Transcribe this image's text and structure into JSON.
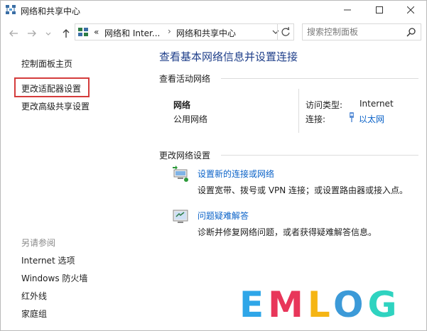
{
  "window": {
    "title": "网络和共享中心",
    "controls": [
      "minimize-icon",
      "maximize-icon",
      "close-icon"
    ]
  },
  "navigation": {
    "breadcrumb_prefix": "«",
    "breadcrumb": [
      "网络和 Inter...",
      "网络和共享中心"
    ],
    "separator": "›",
    "search_placeholder": "搜索控制面板"
  },
  "left_pane": {
    "links": [
      "控制面板主页",
      "更改适配器设置",
      "更改高级共享设置"
    ],
    "highlighted_link": "更改适配器设置",
    "see_also_header": "另请参阅",
    "see_also": [
      "Internet 选项",
      "Windows 防火墙",
      "红外线",
      "家庭组"
    ]
  },
  "main": {
    "heading": "查看基本网络信息并设置连接",
    "active_networks_header": "查看活动网络",
    "network_name": "网络",
    "network_type": "公用网络",
    "access_type_label": "访问类型:",
    "access_type_value": "Internet",
    "connections_label": "连接:",
    "connection_link": "以太网",
    "change_settings_header": "更改网络设置",
    "tasks": [
      {
        "title": "设置新的连接或网络",
        "desc": "设置宽带、拨号或 VPN 连接；或设置路由器或接入点。",
        "icon": "new-connection-icon"
      },
      {
        "title": "问题疑难解答",
        "desc": "诊断并修复网络问题，或者获得疑难解答信息。",
        "icon": "troubleshoot-icon"
      }
    ]
  },
  "watermark": {
    "text": "EMLOG",
    "colors": [
      "#2fa6e8",
      "#e8365a",
      "#f5b514",
      "#3c9ad8",
      "#2fd3c0"
    ]
  },
  "colors": {
    "link": "#0a62c8",
    "heading": "#1f3f8a",
    "highlight_border": "#d43c3c"
  }
}
